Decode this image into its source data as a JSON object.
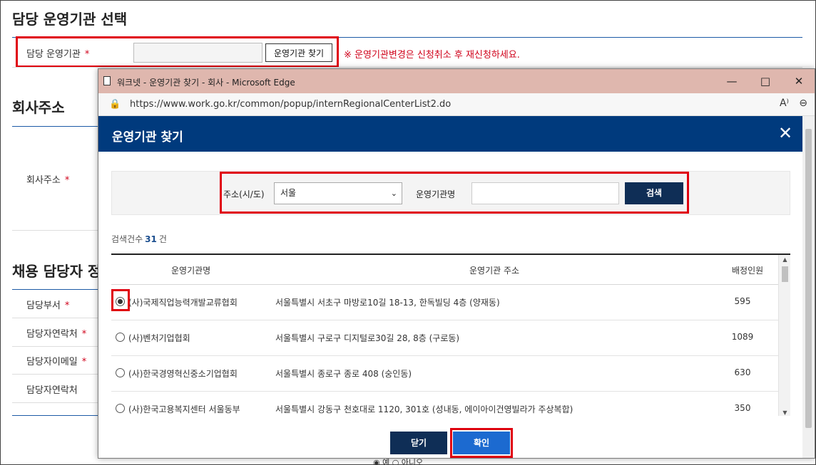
{
  "background": {
    "section1_title": "담당 운영기관 선택",
    "agency_label": "담당 운영기관",
    "required_mark": "*",
    "find_button": "운영기관 찾기",
    "warning": "※ 운영기관변경은 신청취소 후 재신청하세요.",
    "section2_title": "회사주소",
    "address_label": "회사주소",
    "section3_title": "채용 담당자 정",
    "contact_rows": [
      "담당부서",
      "담당자연락처",
      "담당자이메일",
      "담당자연락처"
    ],
    "bottom_radio_text": "◉ 예 ○ 아니오"
  },
  "window": {
    "title": "워크넷 - 운영기관 찾기 - 회사 - Microsoft Edge",
    "url": "https://www.work.go.kr/common/popup/internRegionalCenterList2.do",
    "controls": [
      "—",
      "□",
      "✕"
    ]
  },
  "modal": {
    "title": "운영기관 찾기",
    "search": {
      "sido_label": "주소(시/도)",
      "sido_value": "서울",
      "name_label": "운영기관명",
      "name_value": "",
      "search_button": "검색"
    },
    "result": {
      "count_prefix": "검색건수",
      "count": "31",
      "count_suffix": "건"
    },
    "table": {
      "headers": [
        "운영기관명",
        "운영기관 주소",
        "배정인원"
      ],
      "rows": [
        {
          "name": "(사)국제직업능력개발교류협회",
          "address": "서울특별시 서초구 마방로10길 18-13, 한독빌딩 4층 (양재동)",
          "count": "595",
          "selected": true
        },
        {
          "name": "(사)벤처기업협회",
          "address": "서울특별시 구로구 디지털로30길 28, 8층 (구로동)",
          "count": "1089",
          "selected": false
        },
        {
          "name": "(사)한국경영혁신중소기업협회",
          "address": "서울특별시 종로구 종로 408 (숭인동)",
          "count": "630",
          "selected": false
        },
        {
          "name": "(사)한국고용복지센터 서울동부",
          "address": "서울특별시 강동구 천호대로 1120, 301호 (성내동, 에이아이건영빌라가 주상복합)",
          "count": "350",
          "selected": false
        }
      ]
    },
    "buttons": {
      "close": "닫기",
      "confirm": "확인"
    }
  },
  "colors": {
    "header_blue": "#003a7d",
    "dark_button": "#0f2e56",
    "confirm_blue": "#1c6ad0",
    "highlight_red": "#e0000f",
    "titlebar": "#dfb7ae"
  }
}
